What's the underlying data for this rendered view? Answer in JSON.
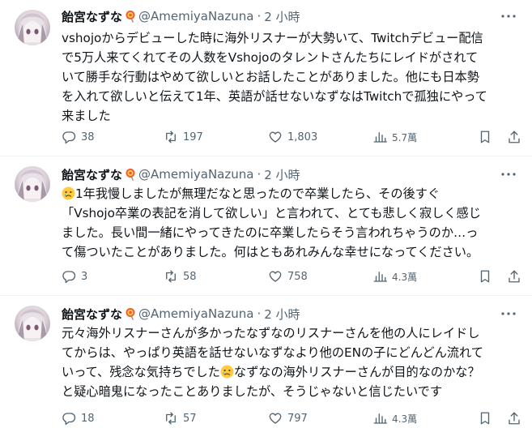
{
  "tweets": [
    {
      "author": {
        "display_name": "飴宮なずな",
        "handle": "@AmemiyaNazuna"
      },
      "dot": "·",
      "time": "2 小時",
      "text_lines": [
        "vshojoからデビューした時に海外リスナーが大勢いて、Twitchデビュー配信",
        "で5万人来てくれてその人数をVshojoのタレントさんたちにレイドがされて",
        "いて勝手な行動はやめて欲しいとお話したことがありました。他にも日本勢",
        "を入れて欲しいと伝えて1年、英語が話せないなずなはTwitchで孤独にやって",
        "来ました"
      ],
      "stats": {
        "replies": "38",
        "retweets": "197",
        "likes": "1,803",
        "views": "5.7萬"
      }
    },
    {
      "author": {
        "display_name": "飴宮なずな",
        "handle": "@AmemiyaNazuna"
      },
      "dot": "·",
      "time": "2 小時",
      "text_lines": [
        "1年我慢しましたが無理だなと思ったので卒業したら、その後すぐ",
        "「Vshojo卒業の表記を消して欲しい」と言われて、とても悲しく寂しく感じ",
        "ました。長い間一緒にやってきたのに卒業したらそう言われちゃうのか…っ",
        "て傷ついたことがありました。何はともあれみんな幸せになってください。"
      ],
      "stats": {
        "replies": "3",
        "retweets": "58",
        "likes": "758",
        "views": "4.3萬"
      }
    },
    {
      "author": {
        "display_name": "飴宮なずな",
        "handle": "@AmemiyaNazuna"
      },
      "dot": "·",
      "time": "2 小時",
      "text_lines": [
        "元々海外リスナーさんが多かったなずなのリスナーさんを他の人にレイドし",
        "てからは、やっぱり英語を話せないなずなより他のENの子にどんどん流れて",
        "いって、残念な気持ちでした",
        "なずなの海外リスナーさんが目的なのかな？",
        "と疑心暗鬼になったことありましたが、そうじゃないと信じたいです"
      ],
      "stats": {
        "replies": "18",
        "retweets": "57",
        "likes": "797",
        "views": "4.3萬"
      }
    }
  ],
  "icons": {
    "lollipop": "lollipop-emoji",
    "tear": "sad-tear-emoji",
    "more": "more-icon",
    "reply": "reply-icon",
    "retweet": "retweet-icon",
    "like": "like-icon",
    "views": "views-icon",
    "bookmark": "bookmark-icon",
    "share": "share-icon"
  },
  "colors": {
    "text": "#0f1419",
    "secondary": "#536471",
    "divider": "#eff3f4"
  }
}
